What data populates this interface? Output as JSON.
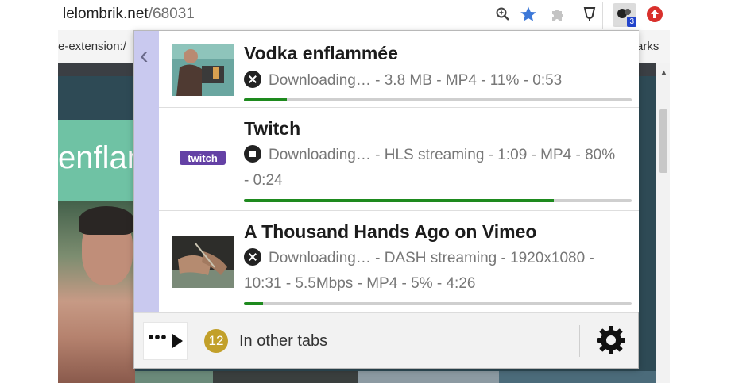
{
  "browser": {
    "url_host": "lelombrik.net",
    "url_path": "/68031",
    "extension_badge": "3",
    "bookmark_left": "e-extension:/",
    "bookmark_right": "arks"
  },
  "page": {
    "banner_text": "enflam"
  },
  "popup": {
    "items": [
      {
        "title": "Vodka enflammée",
        "status": "Downloading… - 3.8 MB - MP4 - 11% - 0:53",
        "progress": 0.11,
        "action_icon": "close-circle-icon"
      },
      {
        "title": "Twitch",
        "status": "Downloading… - HLS streaming - 1:09 - MP4 - 80% - 0:24",
        "progress": 0.8,
        "action_icon": "stop-circle-icon",
        "thumb_logo": "twitch"
      },
      {
        "title": "A Thousand Hands Ago on Vimeo",
        "status": "Downloading… - DASH streaming - 1920x1080 - 10:31 - 5.5Mbps - MP4 - 5% - 4:26",
        "progress": 0.05,
        "action_icon": "close-circle-icon"
      }
    ],
    "footer": {
      "more_label": "•••",
      "other_tabs_count": "12",
      "other_tabs_label": "In other tabs"
    }
  },
  "colors": {
    "progress_fill": "#1e8a1e",
    "back_column": "#c9c9ef",
    "count_badge": "#c2a02a"
  }
}
